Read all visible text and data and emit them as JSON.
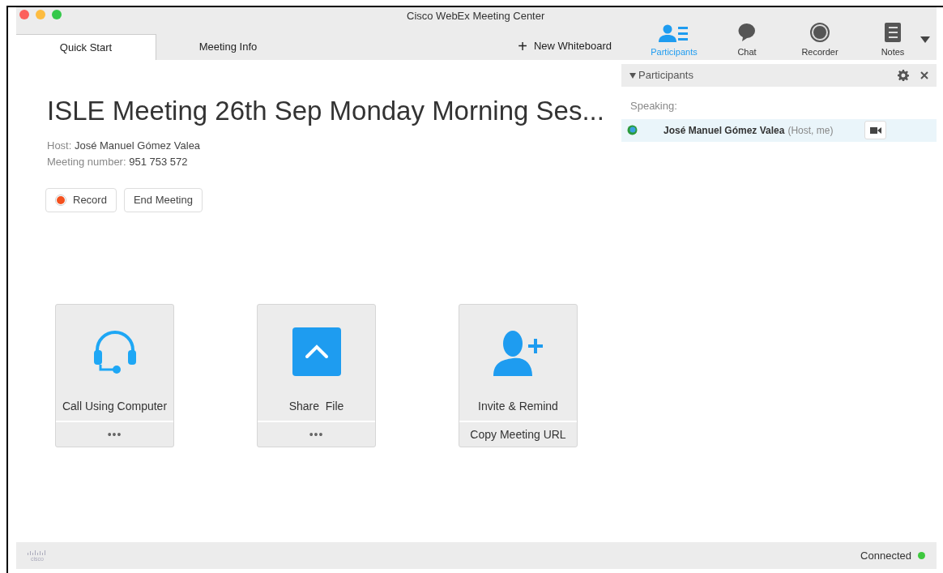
{
  "window": {
    "title": "Cisco WebEx Meeting Center"
  },
  "tabs": [
    {
      "label": "Quick Start",
      "selected": true
    },
    {
      "label": "Meeting Info",
      "selected": false
    }
  ],
  "new_whiteboard": {
    "icon": "+",
    "label": "New Whiteboard"
  },
  "toolbar": [
    {
      "kind": "participants",
      "label": "Participants",
      "selected": true
    },
    {
      "kind": "chat",
      "label": "Chat",
      "selected": false
    },
    {
      "kind": "recorder",
      "label": "Recorder",
      "selected": false
    },
    {
      "kind": "notes",
      "label": "Notes",
      "selected": false
    }
  ],
  "meeting": {
    "title": "ISLE Meeting 26th Sep Monday Morning Ses...",
    "host_label": "Host:",
    "host": "José Manuel Gómez Valea",
    "number_label": "Meeting number:",
    "number": "951 753 572"
  },
  "actions": [
    {
      "kind": "record",
      "label": "Record"
    },
    {
      "kind": "end",
      "label": "End Meeting"
    }
  ],
  "cards": [
    {
      "kind": "headset",
      "label": "Call Using Computer",
      "footer": "•••"
    },
    {
      "kind": "share",
      "label": "Share  File",
      "footer": "•••"
    },
    {
      "kind": "invite",
      "label": "Invite & Remind",
      "footer": "Copy Meeting URL"
    }
  ],
  "participants_panel": {
    "title": "Participants",
    "expanded": true,
    "section": "Speaking:",
    "participants": [
      {
        "name": "José Manuel Gómez Valea",
        "role": "(Host, me)"
      }
    ]
  },
  "status_bar": {
    "logo": "cisco",
    "status": "Connected",
    "connected": true
  }
}
